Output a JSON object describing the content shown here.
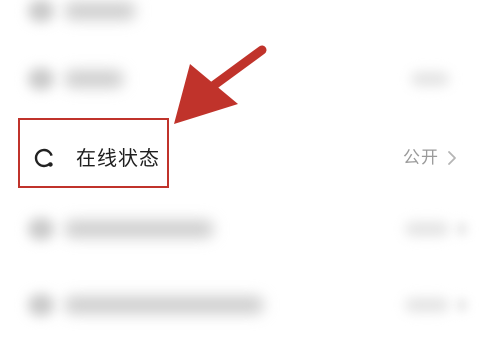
{
  "online_status_row": {
    "label": "在线状态",
    "value": "公开",
    "icon": "online-status-ring-icon",
    "chevron_icon": "chevron-right-icon"
  },
  "annotation": {
    "highlight_color": "#c0332b",
    "arrow_color": "#c0332b"
  },
  "colors": {
    "label_text": "#1f1f1f",
    "value_text": "#9a9a9a",
    "background": "#ffffff"
  }
}
